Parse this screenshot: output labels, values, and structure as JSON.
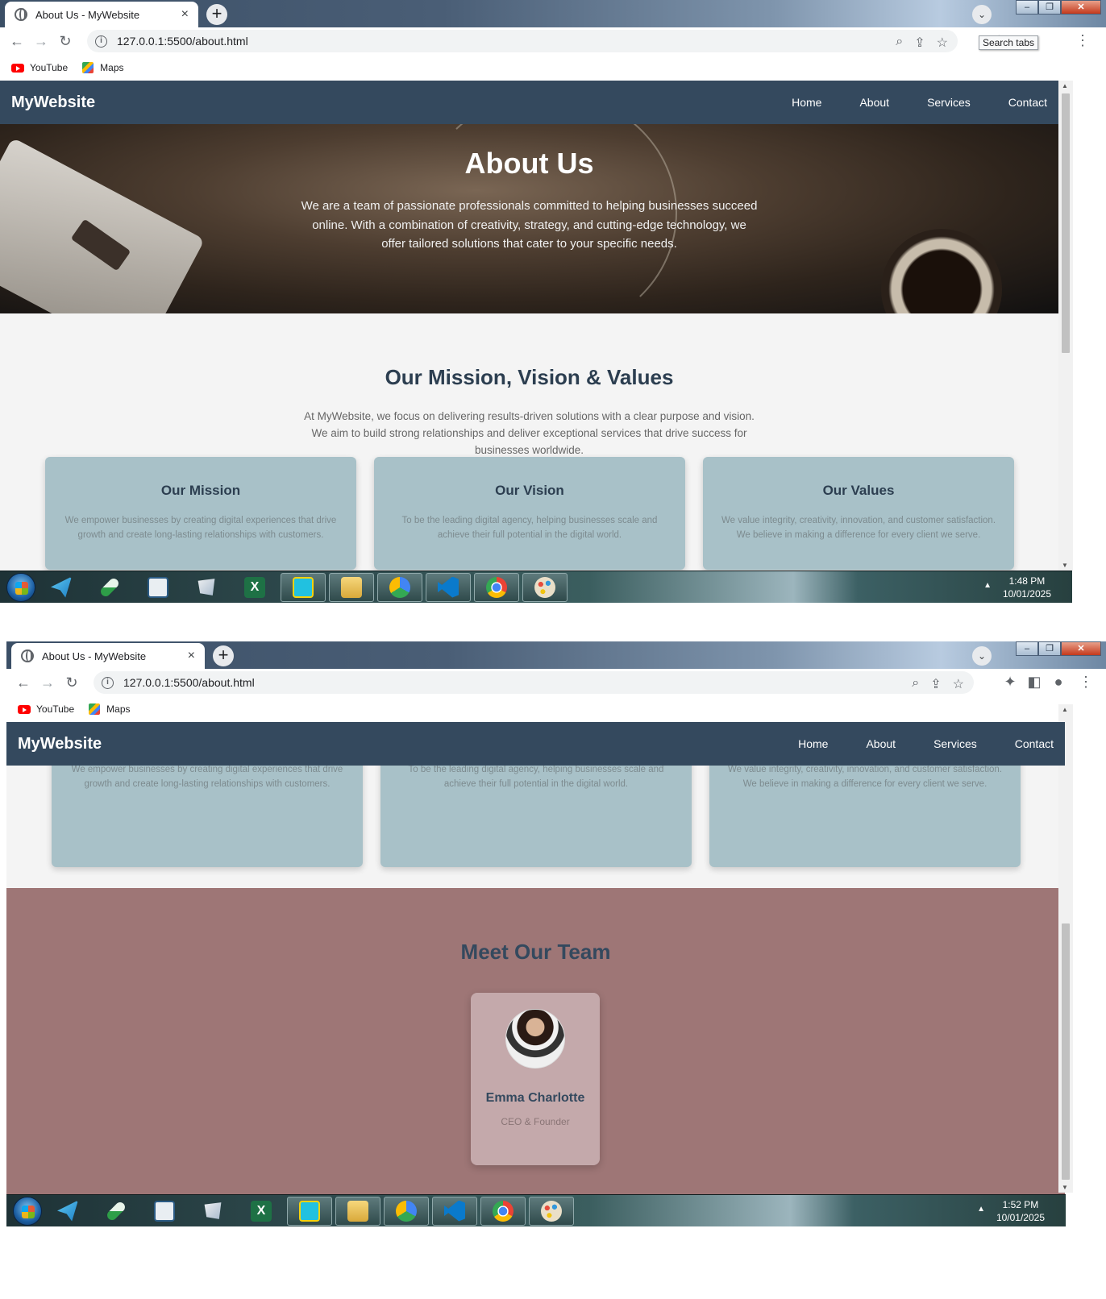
{
  "browser": {
    "tab_title": "About Us - MyWebsite",
    "tab_close": "×",
    "new_tab": "+",
    "url": "127.0.0.1:5500/about.html",
    "tooltip": "Search tabs",
    "bookmarks": [
      {
        "label": "YouTube",
        "icon": "youtube-icon"
      },
      {
        "label": "Maps",
        "icon": "maps-icon"
      }
    ]
  },
  "site": {
    "brand": "MyWebsite",
    "nav": [
      "Home",
      "About",
      "Services",
      "Contact"
    ],
    "hero": {
      "title": "About Us",
      "text": "We are a team of passionate professionals committed to helping businesses succeed online. With a combination of creativity, strategy, and cutting-edge technology, we offer tailored solutions that cater to your specific needs."
    },
    "mission": {
      "title": "Our Mission, Vision & Values",
      "intro": "At MyWebsite, we focus on delivering results-driven solutions with a clear purpose and vision. We aim to build strong relationships and deliver exceptional services that drive success for businesses worldwide.",
      "cards": [
        {
          "title": "Our Mission",
          "text": "We empower businesses by creating digital experiences that drive growth and create long-lasting relationships with customers."
        },
        {
          "title": "Our Vision",
          "text": "To be the leading digital agency, helping businesses scale and achieve their full potential in the digital world."
        },
        {
          "title": "Our Values",
          "text": "We value integrity, creativity, innovation, and customer satisfaction. We believe in making a difference for every client we serve."
        }
      ]
    },
    "team": {
      "title": "Meet Our Team",
      "members": [
        {
          "name": "Emma Charlotte",
          "role": "CEO & Founder"
        }
      ]
    }
  },
  "taskbar": {
    "shot1": {
      "time": "1:48 PM",
      "date": "10/01/2025"
    },
    "shot2": {
      "time": "1:52 PM",
      "date": "10/01/2025"
    },
    "apps": [
      "telegram-icon",
      "pill-icon",
      "window-icon",
      "scissors-icon",
      "excel-icon",
      "paint-tool-icon",
      "file-explorer-icon",
      "chrome-canary-icon",
      "vscode-icon",
      "chrome-icon",
      "palette-icon"
    ]
  }
}
